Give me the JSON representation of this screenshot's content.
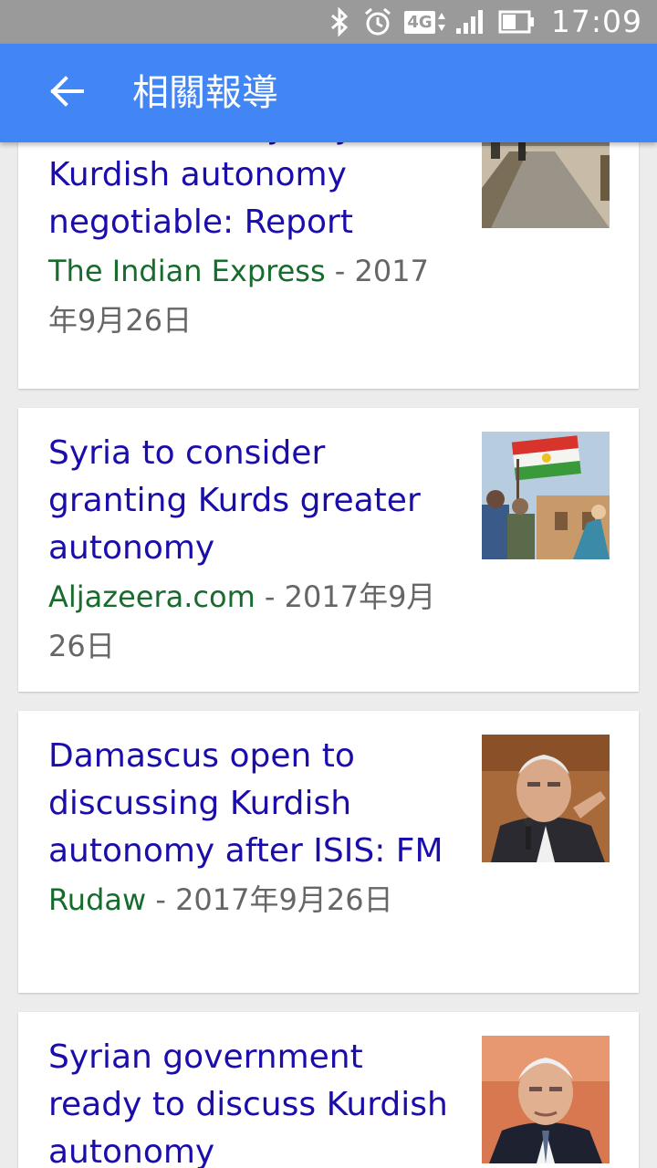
{
  "status_bar": {
    "time": "17:09",
    "network": "4G",
    "icons": [
      "bluetooth-icon",
      "alarm-icon",
      "network-4g-icon",
      "signal-icon",
      "battery-icon"
    ]
  },
  "app_bar": {
    "back_icon": "arrow-left-icon",
    "title": "相關報導",
    "color": "#4285f4"
  },
  "articles": [
    {
      "headline": "Damascus says Syrian Kurdish autonomy negotiable: Report",
      "source": "The Indian Express",
      "separator": " - ",
      "date": "2017年9月26日",
      "thumbnail": "soldiers-road-photo"
    },
    {
      "headline": "Syria to consider granting Kurds greater autonomy",
      "source": "Aljazeera.com",
      "separator": " - ",
      "date": "2017年9月26日",
      "thumbnail": "kurdish-flag-photo"
    },
    {
      "headline": "Damascus open to discussing Kurdish autonomy after ISIS: FM",
      "source": "Rudaw",
      "separator": " - ",
      "date": "2017年9月26日",
      "thumbnail": "minister-speaking-photo"
    },
    {
      "headline": "Syrian government ready to discuss Kurdish autonomy",
      "source": "",
      "separator": "",
      "date": "",
      "thumbnail": "minister-portrait-photo"
    }
  ],
  "colors": {
    "headline": "#1a0dab",
    "source": "#176b2c",
    "meta": "#666666",
    "status_bar": "#9a9a9a"
  }
}
